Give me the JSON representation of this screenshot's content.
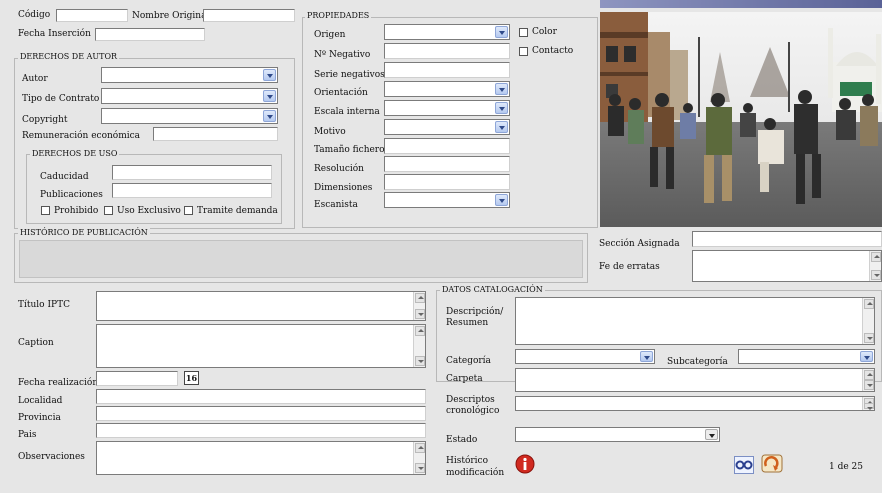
{
  "header": {
    "codigo_label": "Código",
    "nombre_original_label": "Nombre Original",
    "fecha_insercion_label": "Fecha Inserción"
  },
  "derechos": {
    "title": "DERECHOS DE AUTOR",
    "autor_label": "Autor",
    "tipo_contrato_label": "Tipo de Contrato",
    "copyright_label": "Copyright",
    "remuneracion_label": "Remuneración económica"
  },
  "uso": {
    "title": "DERECHOS DE USO",
    "caducidad_label": "Caducidad",
    "publicaciones_label": "Publicaciones",
    "prohibido_label": "Prohibido",
    "exclusivo_label": "Uso Exclusivo",
    "tramite_label": "Tramite demanda"
  },
  "propiedades": {
    "title": "PROPIEDADES",
    "origen_label": "Origen",
    "negativo_label": "Nº Negativo",
    "serie_label": "Serie negativos",
    "orientacion_label": "Orientación",
    "escala_label": "Escala interna",
    "motivo_label": "Motivo",
    "tamano_label": "Tamaño fichero",
    "resolucion_label": "Resolución",
    "dimensiones_label": "Dimensiones",
    "escanista_label": "Escanista",
    "color_label": "Color",
    "contacto_label": "Contacto"
  },
  "historico": {
    "title": "HISTÓRICO DE PUBLICACIÓN"
  },
  "side": {
    "seccion_label": "Sección Asignada",
    "fe_errores_label": "Fe de erratas"
  },
  "iptc": {
    "titulo_label": "Título IPTC",
    "caption_label": "Caption",
    "fecha_realizacion_label": "Fecha realización",
    "calendar_value": "16",
    "localidad_label": "Localidad",
    "provincia_label": "Provincia",
    "pais_label": "Pais",
    "observaciones_label": "Observaciones"
  },
  "catalogacion": {
    "title": "DATOS CATALOGACIÓN",
    "descripcion_label_1": "Descripción/",
    "descripcion_label_2": "Resumen",
    "categoria_label": "Categoría",
    "subcategoria_label": "Subcategoría",
    "carpeta_label": "Carpeta",
    "descriptores_label_1": "Descriptos",
    "descriptores_label_2": "cronológico",
    "estado_label": "Estado",
    "historico_label_1": "Histórico",
    "historico_label_2": "modificación"
  },
  "pager": {
    "text": "1 de 25"
  },
  "colors": {
    "dropdown_blue": "#b5c9ef",
    "panel_bg": "#e6e6e6",
    "info_icon_red": "#d02a20"
  }
}
